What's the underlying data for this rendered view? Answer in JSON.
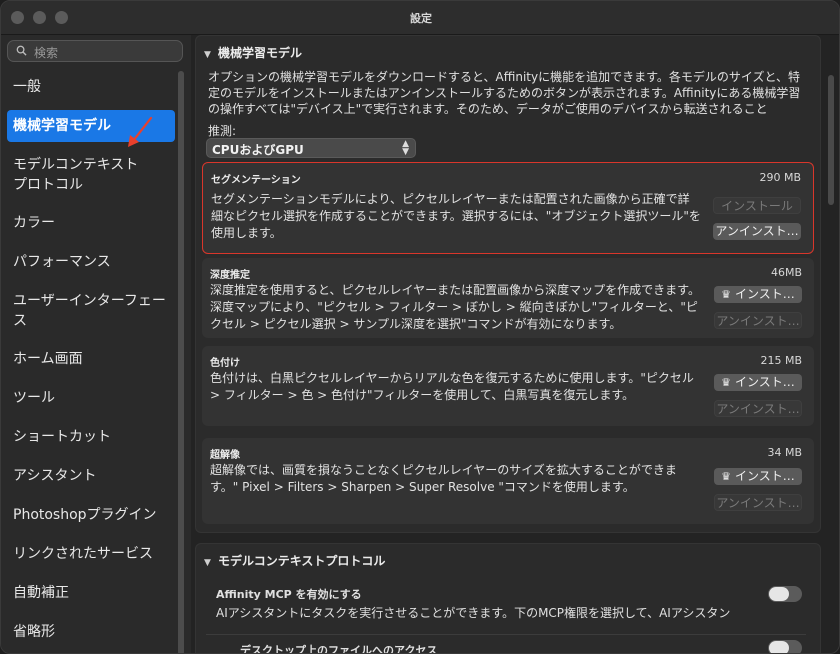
{
  "window": {
    "title": "設定"
  },
  "search": {
    "placeholder": "検索"
  },
  "sidebar": {
    "items": [
      {
        "label": "一般"
      },
      {
        "label": "機械学習モデル"
      },
      {
        "label": "モデルコンテキスト\nプロトコル"
      },
      {
        "label": "カラー"
      },
      {
        "label": "パフォーマンス"
      },
      {
        "label": "ユーザーインターフェース"
      },
      {
        "label": "ホーム画面"
      },
      {
        "label": "ツール"
      },
      {
        "label": "ショートカット"
      },
      {
        "label": "アシスタント"
      },
      {
        "label": "Photoshopプラグイン"
      },
      {
        "label": "リンクされたサービス"
      },
      {
        "label": "自動補正"
      },
      {
        "label": "省略形"
      }
    ]
  },
  "ml_section": {
    "header": "機械学習モデル",
    "description": "オプションの機械学習モデルをダウンロードすると、Affinityに機能を追加できます。各モデルのサイズと、特定のモデルをインストールまたはアンインストールするためのボタンが表示されます。Affinityにある機械学習の操作すべては\"デバイス上\"で実行されます。そのため、データがご使用のデバイスから転送されること",
    "inference_label": "推測:",
    "inference_value": "CPUおよびGPU",
    "models": [
      {
        "title": "セグメンテーション",
        "size": "290 MB",
        "description": "セグメンテーションモデルにより、ピクセルレイヤーまたは配置された画像から正確で詳細なピクセル選択を作成することができます。選択するには、\"オブジェクト選択ツール\"を使用します。",
        "install_label": "インストール",
        "uninstall_label": "アンインスト…"
      },
      {
        "title": "深度推定",
        "size": "46MB",
        "description": "深度推定を使用すると、ピクセルレイヤーまたは配置画像から深度マップを作成できます。深度マップにより、\"ピクセル > フィルター > ぼかし > 縦向きぼかし\"フィルターと、\"ピクセル > ピクセル選択 > サンプル深度を選択\"コマンドが有効になります。",
        "install_label": "インスト…",
        "uninstall_label": "アンインスト…"
      },
      {
        "title": "色付け",
        "size": "215 MB",
        "description": "色付けは、白黒ピクセルレイヤーからリアルな色を復元するために使用します。\"ピクセル > フィルター > 色 > 色付け\"フィルターを使用して、白黒写真を復元します。",
        "install_label": "インスト…",
        "uninstall_label": "アンインスト…"
      },
      {
        "title": "超解像",
        "size": "34 MB",
        "description": "超解像では、画質を損なうことなくピクセルレイヤーのサイズを拡大することができます。\" Pixel > Filters > Sharpen > Super Resolve \"コマンドを使用します。",
        "install_label": "インスト…",
        "uninstall_label": "アンインスト…"
      }
    ]
  },
  "mcp_section": {
    "header": "モデルコンテキストプロトコル",
    "enable_label": "Affinity MCP を有効にする",
    "enable_desc": "AIアシスタントにタスクを実行させることができます。下のMCP権限を選択して、AIアシスタン",
    "file_access_label": "デスクトップ上のファイルへのアクセス"
  },
  "colors": {
    "accent": "#1a78e6",
    "highlight": "#d9362b",
    "annotation_arrow": "#e8402c"
  }
}
